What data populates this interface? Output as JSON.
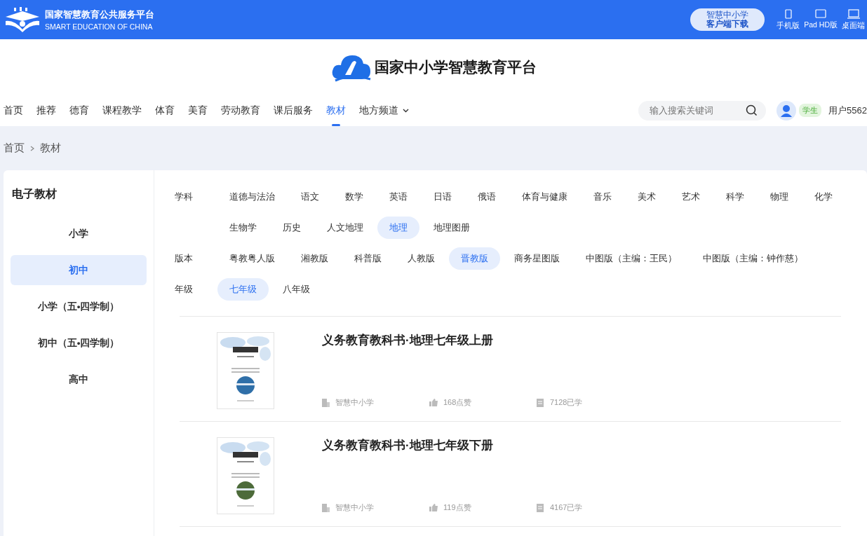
{
  "topbar": {
    "platform_name": "国家智慧教育公共服务平台",
    "platform_name_en": "SMART EDUCATION OF CHINA",
    "download_button": [
      "智慧中小学",
      "客户端下载"
    ],
    "devices": [
      {
        "kind": "phone",
        "label": "手机版"
      },
      {
        "kind": "pad",
        "label": "Pad HD版"
      },
      {
        "kind": "desktop",
        "label": "桌面端"
      }
    ]
  },
  "site_title": "国家中小学智慧教育平台",
  "nav": {
    "items": [
      {
        "label": "首页",
        "selected": false
      },
      {
        "label": "推荐",
        "selected": false
      },
      {
        "label": "德育",
        "selected": false
      },
      {
        "label": "课程教学",
        "selected": false
      },
      {
        "label": "体育",
        "selected": false
      },
      {
        "label": "美育",
        "selected": false
      },
      {
        "label": "劳动教育",
        "selected": false
      },
      {
        "label": "课后服务",
        "selected": false
      },
      {
        "label": "教材",
        "selected": true
      },
      {
        "label": "地方频道",
        "selected": false,
        "dropdown": true
      }
    ],
    "search": {
      "placeholder": "输入搜索关键词"
    },
    "user": {
      "role": "学生",
      "name": "用户5562"
    }
  },
  "breadcrumb": [
    "首页",
    "教材"
  ],
  "sidebar": {
    "title": "电子教材",
    "items": [
      {
        "label": "小学",
        "selected": false
      },
      {
        "label": "初中",
        "selected": true
      },
      {
        "label": "小学（五•四学制）",
        "selected": false
      },
      {
        "label": "初中（五•四学制）",
        "selected": false
      },
      {
        "label": "高中",
        "selected": false
      }
    ]
  },
  "filters": [
    {
      "label": "学科",
      "options": [
        {
          "label": "道德与法治",
          "selected": false
        },
        {
          "label": "语文",
          "selected": false
        },
        {
          "label": "数学",
          "selected": false
        },
        {
          "label": "英语",
          "selected": false
        },
        {
          "label": "日语",
          "selected": false
        },
        {
          "label": "俄语",
          "selected": false
        },
        {
          "label": "体育与健康",
          "selected": false
        },
        {
          "label": "音乐",
          "selected": false
        },
        {
          "label": "美术",
          "selected": false
        },
        {
          "label": "艺术",
          "selected": false
        },
        {
          "label": "科学",
          "selected": false
        },
        {
          "label": "物理",
          "selected": false
        },
        {
          "label": "化学",
          "selected": false
        },
        {
          "label": "生物学",
          "selected": false
        },
        {
          "label": "历史",
          "selected": false
        },
        {
          "label": "人文地理",
          "selected": false
        },
        {
          "label": "地理",
          "selected": true
        },
        {
          "label": "地理图册",
          "selected": false
        }
      ]
    },
    {
      "label": "版本",
      "options": [
        {
          "label": "粤教粤人版",
          "selected": false
        },
        {
          "label": "湘教版",
          "selected": false
        },
        {
          "label": "科普版",
          "selected": false
        },
        {
          "label": "人教版",
          "selected": false
        },
        {
          "label": "晋教版",
          "selected": true
        },
        {
          "label": "商务星图版",
          "selected": false
        },
        {
          "label": "中图版（主编：王民）",
          "selected": false
        },
        {
          "label": "中图版（主编：钟作慈）",
          "selected": false
        }
      ]
    },
    {
      "label": "年级",
      "options": [
        {
          "label": "七年级",
          "selected": true
        },
        {
          "label": "八年级",
          "selected": false
        }
      ]
    }
  ],
  "books": [
    {
      "title": "义务教育教科书·地理七年级上册",
      "publisher": "智慧中小学",
      "likes": "168点赞",
      "learners": "7128已学"
    },
    {
      "title": "义务教育教科书·地理七年级下册",
      "publisher": "智慧中小学",
      "likes": "119点赞",
      "learners": "4167已学"
    }
  ]
}
